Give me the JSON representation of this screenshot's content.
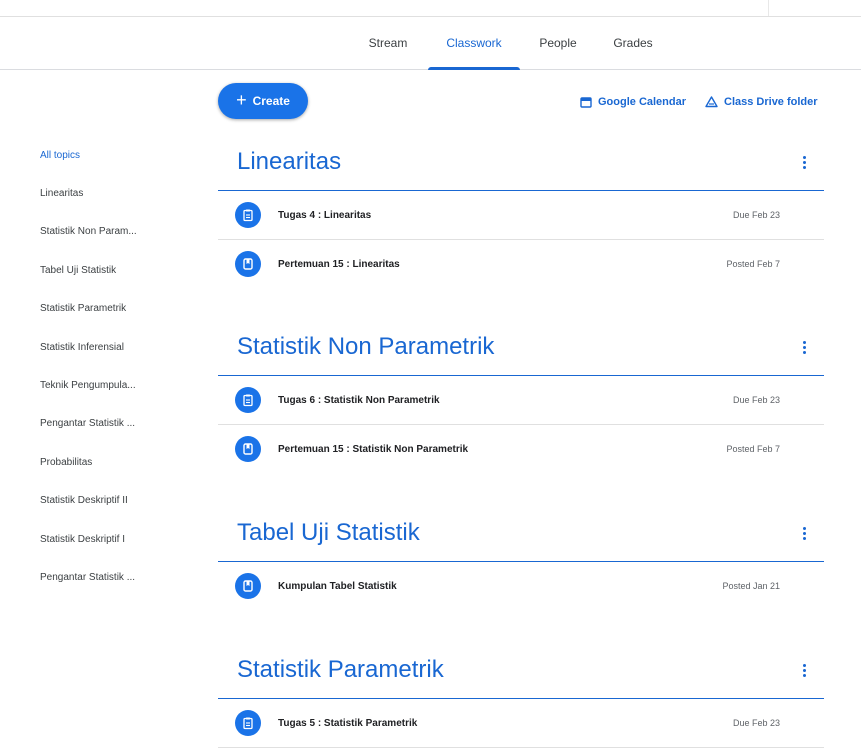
{
  "tabs": [
    {
      "label": "Stream"
    },
    {
      "label": "Classwork"
    },
    {
      "label": "People"
    },
    {
      "label": "Grades"
    }
  ],
  "active_tab": "Classwork",
  "actions": {
    "create_label": "Create",
    "calendar_label": "Google Calendar",
    "drive_label": "Class Drive folder"
  },
  "sidebar": {
    "items": [
      {
        "label": "All topics"
      },
      {
        "label": "Linearitas"
      },
      {
        "label": "Statistik Non Param..."
      },
      {
        "label": "Tabel Uji Statistik"
      },
      {
        "label": "Statistik Parametrik"
      },
      {
        "label": "Statistik Inferensial"
      },
      {
        "label": "Teknik Pengumpula..."
      },
      {
        "label": "Pengantar Statistik ..."
      },
      {
        "label": "Probabilitas"
      },
      {
        "label": "Statistik Deskriptif II"
      },
      {
        "label": "Statistik Deskriptif I"
      },
      {
        "label": "Pengantar Statistik ..."
      }
    ]
  },
  "topics": [
    {
      "title": "Linearitas",
      "items": [
        {
          "label": "Tugas 4 : Linearitas",
          "date": "Due Feb 23",
          "icon": "assignment-icon"
        },
        {
          "label": "Pertemuan 15 : Linearitas",
          "date": "Posted Feb 7",
          "icon": "material-icon"
        }
      ]
    },
    {
      "title": "Statistik Non Parametrik",
      "items": [
        {
          "label": "Tugas 6 : Statistik Non Parametrik",
          "date": "Due Feb 23",
          "icon": "assignment-icon"
        },
        {
          "label": "Pertemuan 15 : Statistik Non Parametrik",
          "date": "Posted Feb 7",
          "icon": "material-icon"
        }
      ]
    },
    {
      "title": "Tabel Uji Statistik",
      "items": [
        {
          "label": "Kumpulan Tabel Statistik",
          "date": "Posted Jan 21",
          "icon": "material-icon"
        }
      ]
    },
    {
      "title": "Statistik Parametrik",
      "items": [
        {
          "label": "Tugas 5 : Statistik Parametrik",
          "date": "Due Feb 23",
          "icon": "assignment-icon"
        }
      ]
    }
  ],
  "colors": {
    "accent": "#1967d2",
    "button": "#1a73e8",
    "text": "#3c4043",
    "divider": "#e0e0e0"
  }
}
